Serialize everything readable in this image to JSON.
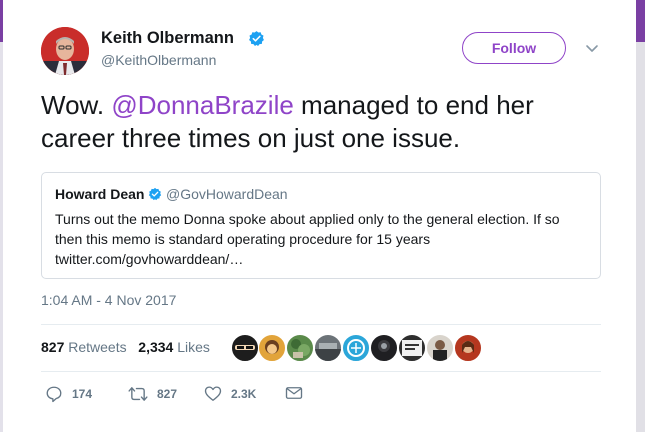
{
  "author": {
    "name": "Keith Olbermann",
    "handle": "@KeithOlbermann",
    "verified": true
  },
  "follow_label": "Follow",
  "tweet": {
    "pre": "Wow. ",
    "mention": "@DonnaBrazile",
    "post": " managed to end her career three times on just one issue."
  },
  "quoted": {
    "name": "Howard Dean",
    "handle": "@GovHowardDean",
    "line1": "Turns out the memo Donna spoke about applied only to the general election. If so",
    "line2": "then this memo is standard operating procedure for 15 years",
    "line3": "twitter.com/govhowarddean/…"
  },
  "timestamp": "1:04 AM - 4 Nov 2017",
  "stats": {
    "retweets_count": "827",
    "retweets_label": "Retweets",
    "likes_count": "2,334",
    "likes_label": "Likes"
  },
  "actions": {
    "replies": "174",
    "retweets": "827",
    "likes": "2.3K"
  },
  "colors": {
    "accent": "#8f44c8",
    "verified": "#1da1f2",
    "muted": "#657786"
  },
  "icons": [
    "verified-badge-icon",
    "chevron-down-icon",
    "reply-icon",
    "retweet-icon",
    "like-heart-icon",
    "direct-message-icon"
  ]
}
